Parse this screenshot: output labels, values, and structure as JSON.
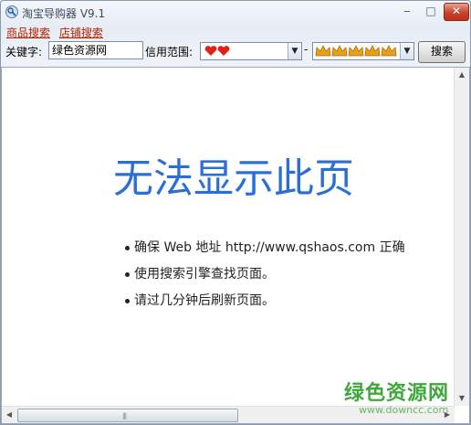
{
  "window": {
    "title": "淘宝导购器 V9.1",
    "minimize_symbol": "‒",
    "maximize_symbol": "□",
    "close_symbol": "✕"
  },
  "tabs": [
    {
      "label": "商品搜索"
    },
    {
      "label": "店铺搜索"
    }
  ],
  "search": {
    "keyword_label": "关键字:",
    "keyword_value": "绿色资源网",
    "credit_label": "信用范围:",
    "credit_min": {
      "icon": "heart-icon",
      "count": 2,
      "color": "#e0201a"
    },
    "range_separator": "-",
    "credit_max": {
      "icon": "crown-icon",
      "count": 5,
      "color": "#e3a21a"
    },
    "search_button": "搜索"
  },
  "browser": {
    "error_title": "无法显示此页",
    "error_items": [
      "确保 Web 地址 http://www.qshaos.com 正确",
      "使用搜索引擎查找页面。",
      "请过几分钟后刷新页面。"
    ]
  },
  "watermark": {
    "logo_text": "绿色资源网",
    "url": "www.downcc.com"
  }
}
